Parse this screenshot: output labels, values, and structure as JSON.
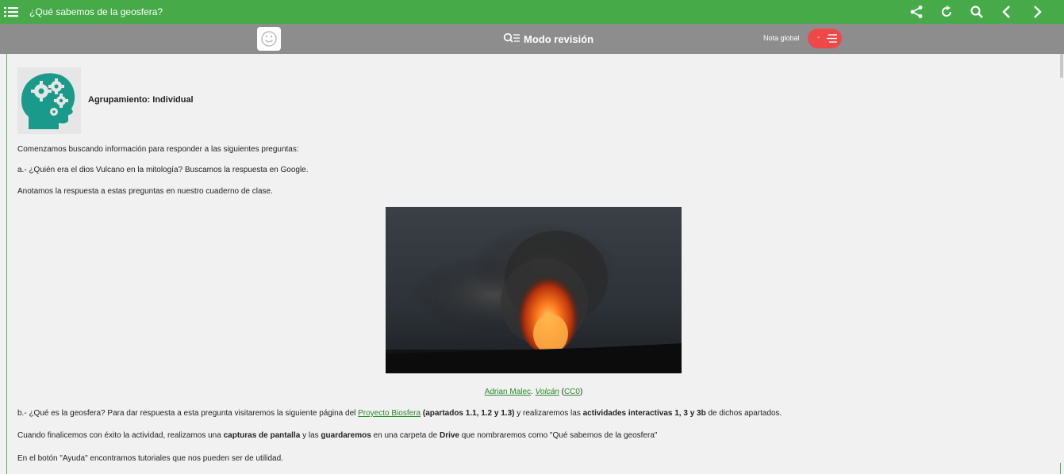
{
  "topbar": {
    "title": "¿Qué sabemos de la geosfera?",
    "icons": [
      "menu-icon",
      "share-icon",
      "refresh-icon",
      "search-icon",
      "chevron-left-icon",
      "chevron-right-icon"
    ]
  },
  "reviewbar": {
    "mode_label": "Modo revisión",
    "grade_label": "Nota global",
    "grade_value": "-"
  },
  "content": {
    "grouping": "Agrupamiento: Individual",
    "p1": "Comenzamos buscando información para responder a las siguientes preguntas:",
    "p2": "a.- ¿Quién era el dios Vulcano en la mitología? Buscamos la respuesta en Google.",
    "p3": "Anotamos la respuesta a estas preguntas en nuestro cuaderno de clase.",
    "credit": {
      "author": "Adrian Malec",
      "sep1": ". ",
      "work": "Volcán",
      "open": " (",
      "license": "CC0",
      "close": ")"
    },
    "p4": {
      "t1": "b.- ¿Qué es la geosfera? Para dar respuesta a esta pregunta visitaremos la siguiente página del ",
      "link": "Proyecto Biosfera",
      "t2": " ",
      "b1": "(apartados 1.1, 1.2 y 1.3)",
      "t3": " y realizaremos las ",
      "b2": "actividades interactivas 1, 3 y 3b",
      "t4": " de dichos apartados."
    },
    "p5": {
      "t1": "Cuando finalicemos con éxito la actividad, realizamos una ",
      "b1": "capturas de pantalla",
      "t2": " y las ",
      "b2": "guardaremos",
      "t3": " en una carpeta de ",
      "b3": "Drive",
      "t4": " que nombraremos como \"Qué sabemos de la geosfera\""
    },
    "p6": "En el botón \"Ayuda\" encontramos tutoriales que nos pueden ser de utilidad."
  },
  "colors": {
    "topbar": "#45aa47",
    "reviewbar": "#8d8d8d",
    "grade_pill": "#f04848",
    "icon_teal": "#1a9a8a",
    "link": "#2a8a2a"
  }
}
